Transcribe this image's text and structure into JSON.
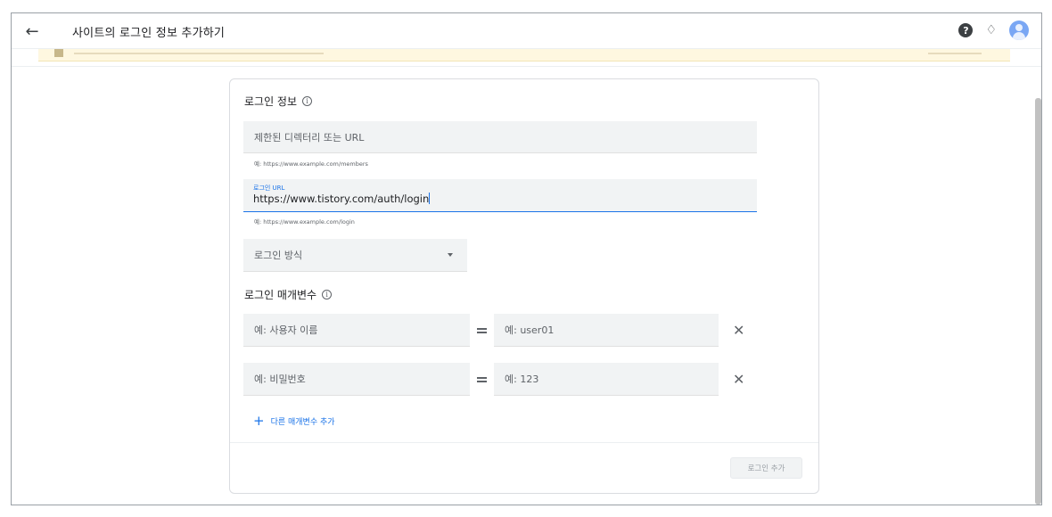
{
  "header": {
    "back_icon": "arrow-left-icon",
    "title": "사이트의 로그인 정보 추가하기",
    "help_icon": "help-circle-icon",
    "notification_icon": "bell-icon",
    "avatar_icon": "account-avatar-icon"
  },
  "login_info": {
    "section_title": "로그인 정보",
    "restricted_dir": {
      "placeholder": "제한된 디렉터리 또는 URL",
      "value": "",
      "hint": "예: https://www.example.com/members"
    },
    "login_url": {
      "label": "로그인 URL",
      "value": "https://www.tistory.com/auth/login",
      "hint": "예: https://www.example.com/login"
    },
    "login_method": {
      "placeholder": "로그인 방식"
    }
  },
  "params": {
    "section_title": "로그인 매개변수",
    "rows": [
      {
        "name_placeholder": "예: 사용자 이름",
        "value_placeholder": "예: user01"
      },
      {
        "name_placeholder": "예: 비밀번호",
        "value_placeholder": "예: 123"
      }
    ],
    "add_label": "다른 매개변수 추가"
  },
  "footer": {
    "submit_label": "로그인 추가"
  },
  "colors": {
    "accent": "#1a73e8",
    "field_bg": "#f1f3f4",
    "banner_bg": "#fef7e0",
    "disabled_text": "#9aa0a6"
  }
}
